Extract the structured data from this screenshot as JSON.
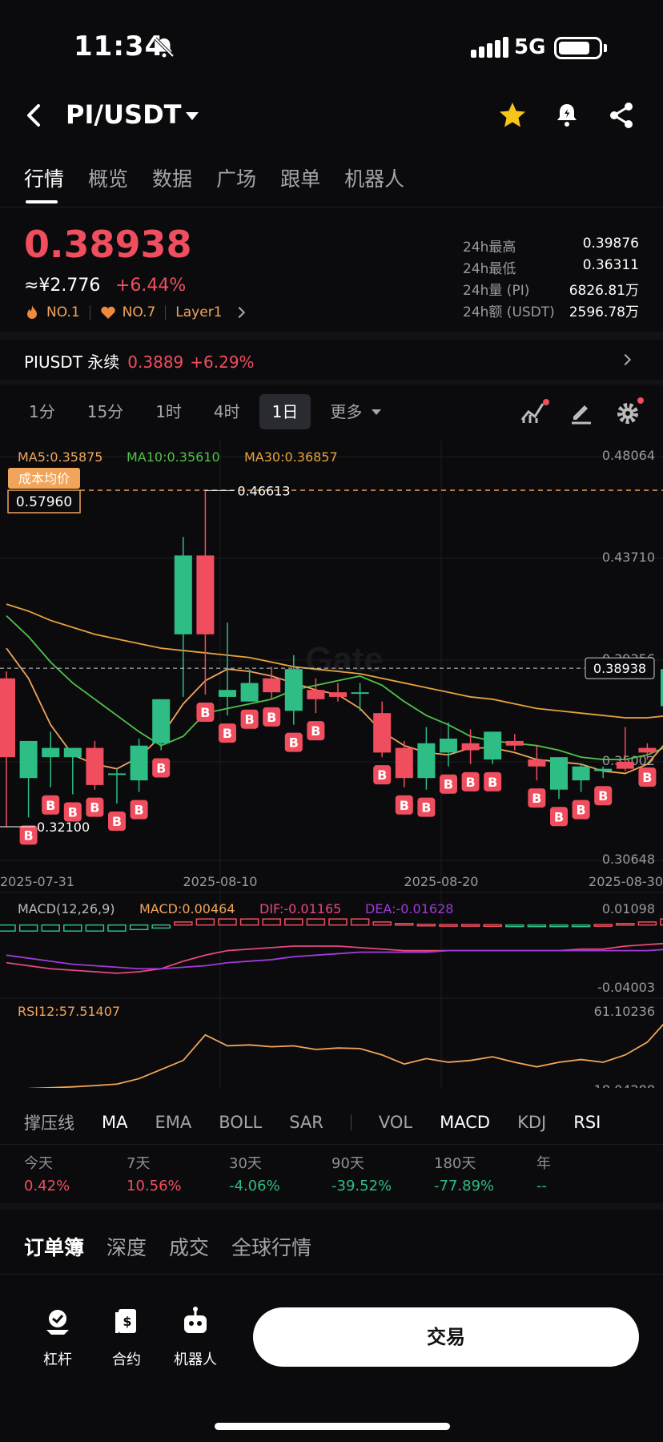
{
  "status_bar": {
    "time": "11:34",
    "network": "5G"
  },
  "header": {
    "pair": "PI/USDT"
  },
  "tabs": [
    "行情",
    "概览",
    "数据",
    "广场",
    "跟单",
    "机器人"
  ],
  "ticker": {
    "price": "0.38938",
    "cny": "≈¥2.776",
    "change": "+6.44%",
    "badges": [
      "NO.1",
      "NO.7",
      "Layer1"
    ],
    "stats": [
      {
        "k": "24h最高",
        "v": "0.39876"
      },
      {
        "k": "24h最低",
        "v": "0.36311"
      },
      {
        "k": "24h量 (PI)",
        "v": "6826.81万"
      },
      {
        "k": "24h额 (USDT)",
        "v": "2596.78万"
      }
    ]
  },
  "perp": {
    "label": "PIUSDT 永续",
    "price": "0.3889",
    "change": "+6.29%"
  },
  "intervals": [
    "1分",
    "15分",
    "1时",
    "4时",
    "1日",
    "更多"
  ],
  "active_interval": "1日",
  "chart": {
    "ma_legend": [
      "MA5:0.35875",
      "MA10:0.35610",
      "MA30:0.36857"
    ],
    "cost_label": "成本均价",
    "cost_value": "0.57960",
    "y_ticks": [
      "0.48064",
      "0.43710",
      "0.39356",
      "0.35002",
      "0.30648"
    ],
    "high_label": "0.46613",
    "low_label": "0.32100",
    "last_price": "0.38938",
    "x_ticks": [
      "2025-07-31",
      "2025-08-10",
      "2025-08-20",
      "2025-08-30"
    ],
    "watermark": "Gate",
    "marker_text": "B"
  },
  "chart_data": [
    {
      "type": "candlestick",
      "dates_label": [
        "2025-07-31",
        "2025-08-10",
        "2025-08-20",
        "2025-08-30"
      ],
      "ylim": [
        0.30648,
        0.48064
      ],
      "candles": [
        {
          "o": 0.385,
          "h": 0.388,
          "l": 0.321,
          "c": 0.351
        },
        {
          "o": 0.342,
          "h": 0.358,
          "l": 0.325,
          "c": 0.358
        },
        {
          "o": 0.351,
          "h": 0.362,
          "l": 0.338,
          "c": 0.355
        },
        {
          "o": 0.351,
          "h": 0.355,
          "l": 0.335,
          "c": 0.355
        },
        {
          "o": 0.355,
          "h": 0.358,
          "l": 0.337,
          "c": 0.339
        },
        {
          "o": 0.344,
          "h": 0.346,
          "l": 0.331,
          "c": 0.344
        },
        {
          "o": 0.341,
          "h": 0.359,
          "l": 0.336,
          "c": 0.356
        },
        {
          "o": 0.357,
          "h": 0.376,
          "l": 0.354,
          "c": 0.376
        },
        {
          "o": 0.404,
          "h": 0.446,
          "l": 0.377,
          "c": 0.438
        },
        {
          "o": 0.438,
          "h": 0.466,
          "l": 0.378,
          "c": 0.404
        },
        {
          "o": 0.377,
          "h": 0.409,
          "l": 0.369,
          "c": 0.38
        },
        {
          "o": 0.375,
          "h": 0.389,
          "l": 0.375,
          "c": 0.383
        },
        {
          "o": 0.385,
          "h": 0.39,
          "l": 0.376,
          "c": 0.379
        },
        {
          "o": 0.371,
          "h": 0.395,
          "l": 0.365,
          "c": 0.389
        },
        {
          "o": 0.38,
          "h": 0.385,
          "l": 0.37,
          "c": 0.376
        },
        {
          "o": 0.379,
          "h": 0.383,
          "l": 0.375,
          "c": 0.377
        },
        {
          "o": 0.379,
          "h": 0.383,
          "l": 0.371,
          "c": 0.379
        },
        {
          "o": 0.37,
          "h": 0.375,
          "l": 0.351,
          "c": 0.353
        },
        {
          "o": 0.355,
          "h": 0.358,
          "l": 0.338,
          "c": 0.342
        },
        {
          "o": 0.342,
          "h": 0.364,
          "l": 0.337,
          "c": 0.357
        },
        {
          "o": 0.353,
          "h": 0.366,
          "l": 0.347,
          "c": 0.359
        },
        {
          "o": 0.357,
          "h": 0.363,
          "l": 0.348,
          "c": 0.354
        },
        {
          "o": 0.35,
          "h": 0.362,
          "l": 0.348,
          "c": 0.362
        },
        {
          "o": 0.358,
          "h": 0.361,
          "l": 0.354,
          "c": 0.356
        },
        {
          "o": 0.35,
          "h": 0.356,
          "l": 0.341,
          "c": 0.347
        },
        {
          "o": 0.337,
          "h": 0.351,
          "l": 0.333,
          "c": 0.351
        },
        {
          "o": 0.341,
          "h": 0.348,
          "l": 0.336,
          "c": 0.347
        },
        {
          "o": 0.345,
          "h": 0.347,
          "l": 0.342,
          "c": 0.346
        },
        {
          "o": 0.349,
          "h": 0.364,
          "l": 0.345,
          "c": 0.346
        },
        {
          "o": 0.355,
          "h": 0.357,
          "l": 0.35,
          "c": 0.353
        },
        {
          "o": 0.373,
          "h": 0.378,
          "l": 0.35,
          "c": 0.389
        }
      ],
      "ma5": [
        0.398,
        0.385,
        0.365,
        0.352,
        0.348,
        0.346,
        0.351,
        0.36,
        0.374,
        0.384,
        0.389,
        0.388,
        0.386,
        0.383,
        0.38,
        0.378,
        0.372,
        0.362,
        0.356,
        0.353,
        0.352,
        0.355,
        0.355,
        0.353,
        0.35,
        0.349,
        0.348,
        0.345,
        0.344,
        0.348,
        0.359
      ],
      "ma10": [
        0.412,
        0.403,
        0.392,
        0.383,
        0.376,
        0.369,
        0.362,
        0.356,
        0.36,
        0.37,
        0.372,
        0.374,
        0.376,
        0.38,
        0.382,
        0.384,
        0.386,
        0.382,
        0.375,
        0.369,
        0.365,
        0.36,
        0.358,
        0.357,
        0.356,
        0.354,
        0.351,
        0.35,
        0.35,
        0.352,
        0.356
      ],
      "ma30": [
        0.417,
        0.414,
        0.41,
        0.407,
        0.404,
        0.402,
        0.4,
        0.398,
        0.397,
        0.396,
        0.395,
        0.394,
        0.392,
        0.39,
        0.389,
        0.388,
        0.387,
        0.385,
        0.383,
        0.381,
        0.379,
        0.377,
        0.376,
        0.374,
        0.372,
        0.371,
        0.37,
        0.369,
        0.368,
        0.368,
        0.369
      ]
    },
    {
      "type": "bar",
      "title": "MACD(12,26,9)",
      "legend": [
        "MACD:0.00464",
        "DIF:-0.01165",
        "DEA:-0.01628"
      ],
      "ylim": [
        -0.04003,
        0.01098
      ],
      "hist": [
        -0.004,
        -0.004,
        -0.004,
        -0.004,
        -0.004,
        -0.004,
        -0.003,
        -0.002,
        0.002,
        0.004,
        0.004,
        0.004,
        0.004,
        0.004,
        0.004,
        0.004,
        0.004,
        0.002,
        0.001,
        0.0005,
        0.0003,
        0.0003,
        0.0002,
        -0.0002,
        -0.0003,
        -0.0003,
        -0.0002,
        0.0003,
        0.001,
        0.002,
        0.004
      ],
      "dif": [
        -0.025,
        -0.027,
        -0.029,
        -0.03,
        -0.031,
        -0.032,
        -0.031,
        -0.029,
        -0.024,
        -0.02,
        -0.017,
        -0.016,
        -0.015,
        -0.014,
        -0.014,
        -0.014,
        -0.015,
        -0.016,
        -0.017,
        -0.017,
        -0.017,
        -0.017,
        -0.017,
        -0.017,
        -0.017,
        -0.017,
        -0.016,
        -0.016,
        -0.014,
        -0.013,
        -0.012
      ],
      "dea": [
        -0.02,
        -0.022,
        -0.024,
        -0.026,
        -0.027,
        -0.028,
        -0.029,
        -0.029,
        -0.028,
        -0.027,
        -0.025,
        -0.024,
        -0.023,
        -0.021,
        -0.02,
        -0.019,
        -0.018,
        -0.018,
        -0.018,
        -0.018,
        -0.017,
        -0.017,
        -0.017,
        -0.017,
        -0.017,
        -0.017,
        -0.017,
        -0.017,
        -0.017,
        -0.017,
        -0.016
      ]
    },
    {
      "type": "line",
      "title": "RSI12:57.51407",
      "ylim": [
        18.04288,
        61.10236
      ],
      "rsi": [
        18.5,
        18.6,
        19.0,
        19.5,
        20.2,
        21.0,
        24.0,
        29.0,
        34.0,
        48.0,
        42.0,
        42.5,
        41.5,
        42.0,
        40.0,
        40.8,
        40.5,
        37.0,
        32.0,
        35.0,
        33.0,
        34.0,
        36.0,
        33.0,
        30.5,
        33.0,
        34.5,
        33.0,
        37.0,
        44.0,
        57.5
      ]
    }
  ],
  "indicator_tabs": {
    "main": [
      "撑压线",
      "MA",
      "EMA",
      "BOLL",
      "SAR"
    ],
    "sub": [
      "VOL",
      "MACD",
      "KDJ",
      "RSI"
    ],
    "active": [
      "MA",
      "MACD",
      "RSI"
    ]
  },
  "performance": [
    {
      "label": "今天",
      "value": "0.42%",
      "color": "#f04e5f"
    },
    {
      "label": "7天",
      "value": "10.56%",
      "color": "#f04e5f"
    },
    {
      "label": "30天",
      "value": "-4.06%",
      "color": "#2ebd85"
    },
    {
      "label": "90天",
      "value": "-39.52%",
      "color": "#2ebd85"
    },
    {
      "label": "180天",
      "value": "-77.89%",
      "color": "#2ebd85"
    },
    {
      "label": "年",
      "value": "--",
      "color": "#2ebd85"
    }
  ],
  "book_tabs": [
    "订单簿",
    "深度",
    "成交",
    "全球行情"
  ],
  "bottom_nav": [
    {
      "label": "杠杆",
      "icon": "leverage-icon"
    },
    {
      "label": "合约",
      "icon": "contract-icon"
    },
    {
      "label": "机器人",
      "icon": "robot-icon"
    }
  ],
  "trade_button": "交易",
  "colors": {
    "up": "#f04e5f",
    "down": "#2ebd85",
    "ma5": "#f0a55a",
    "ma10": "#4fc24a",
    "ma30": "#e8a23c",
    "dif": "#e8487d",
    "dea": "#a03ad8",
    "rsi": "#f0a55a"
  }
}
